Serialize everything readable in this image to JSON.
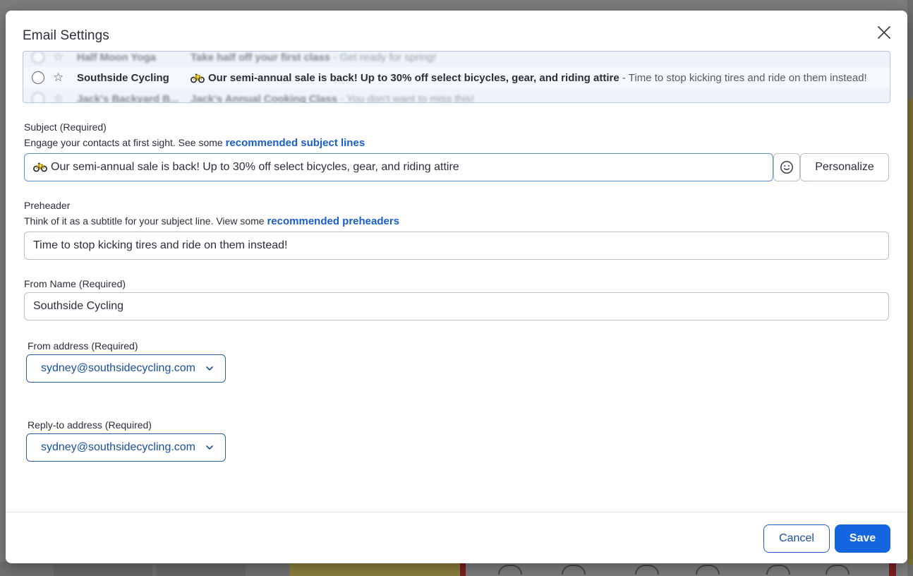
{
  "dialog": {
    "title": "Email Settings"
  },
  "preview": {
    "rows": [
      {
        "sender": "Half Moon Yoga",
        "subject": "Take half off your first class",
        "snippet": " - Get ready for spring!"
      },
      {
        "sender": "Southside Cycling",
        "subject": "Our semi-annual sale is back! Up to 30% off select bicycles, gear, and riding attire",
        "snippet": " - Time to stop kicking tires and ride on them instead!"
      },
      {
        "sender": "Jack's Backyard B...",
        "subject": "Jack's Annual Cooking Class",
        "snippet": " - You don't want to miss this!"
      }
    ]
  },
  "subject": {
    "label": "Subject",
    "required": "(Required)",
    "hint": "Engage your contacts at first sight. See some ",
    "link": "recommended subject lines",
    "value": "Our semi-annual sale is back! Up to 30% off select bicycles, gear, and riding attire",
    "emoji_icon": "smiley-icon",
    "personalize_label": "Personalize"
  },
  "preheader": {
    "label": "Preheader",
    "hint": "Think of it as a subtitle for your subject line. View some ",
    "link": "recommended preheaders",
    "value": "Time to stop kicking tires and ride on them instead!"
  },
  "from_name": {
    "label": "From Name",
    "required": "(Required)",
    "value": "Southside Cycling"
  },
  "from_address": {
    "label": "From address",
    "required": "(Required)",
    "value": "sydney@southsidecycling.com"
  },
  "reply_to": {
    "label": "Reply-to address",
    "required": "(Required)",
    "value": "sydney@southsidecycling.com"
  },
  "footer": {
    "cancel_label": "Cancel",
    "save_label": "Save"
  },
  "colors": {
    "accent": "#1466e0",
    "link": "#1a5fc9",
    "preview_bg": "#eef3fa"
  }
}
